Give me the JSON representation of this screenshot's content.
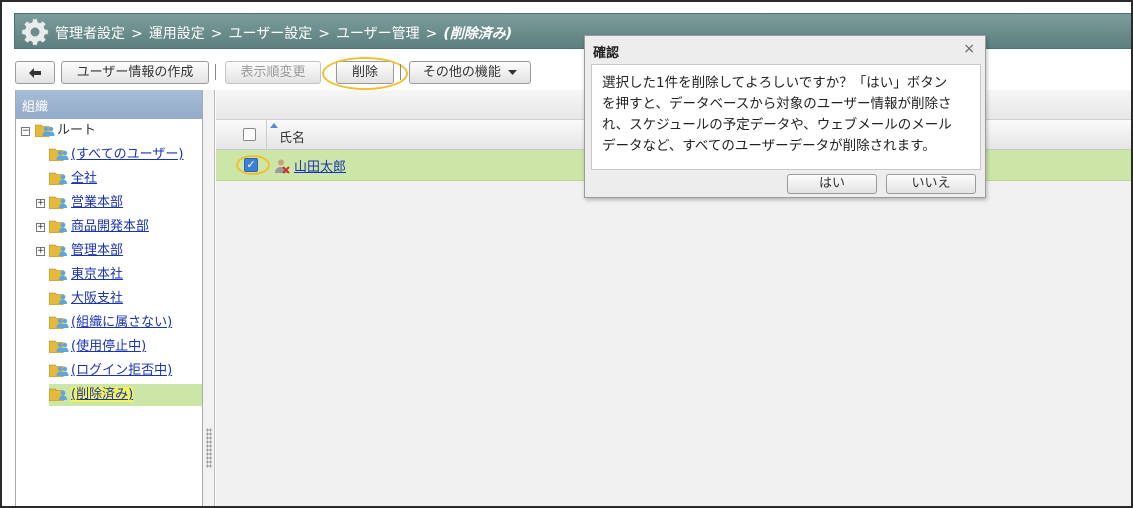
{
  "breadcrumb": {
    "items": [
      "管理者設定",
      "運用設定",
      "ユーザー設定",
      "ユーザー管理"
    ],
    "current": "(削除済み)",
    "separator": ">"
  },
  "toolbar": {
    "back_icon": "back-arrow-icon",
    "create_label": "ユーザー情報の作成",
    "sort_label": "表示順変更",
    "delete_label": "削除",
    "more_label": "その他の機能",
    "divider": "|"
  },
  "sidebar": {
    "header": "組織",
    "root_label": "ルート",
    "items": [
      {
        "label": "(すべてのユーザー)",
        "icon": "multi-user-folder-icon"
      },
      {
        "label": "全社",
        "icon": "user-folder-icon"
      },
      {
        "label": "営業本部",
        "icon": "user-folder-icon",
        "expandable": true
      },
      {
        "label": "商品開発本部",
        "icon": "user-folder-icon",
        "expandable": true
      },
      {
        "label": "管理本部",
        "icon": "user-folder-icon",
        "expandable": true
      },
      {
        "label": "東京本社",
        "icon": "user-folder-icon"
      },
      {
        "label": "大阪支社",
        "icon": "user-folder-icon"
      },
      {
        "label": "(組織に属さない)",
        "icon": "multi-user-folder-icon"
      },
      {
        "label": "(使用停止中)",
        "icon": "multi-user-folder-icon"
      },
      {
        "label": "(ログイン拒否中)",
        "icon": "multi-user-folder-icon"
      },
      {
        "label": "(削除済み)",
        "icon": "user-folder-icon",
        "selected": true
      }
    ]
  },
  "list": {
    "column_name": "氏名",
    "rows": [
      {
        "name": "山田太郎",
        "checked": true,
        "icon": "deleted-user-icon"
      }
    ]
  },
  "dialog": {
    "title": "確認",
    "message_lines": [
      "選択した1件を削除してよろしいですか？「はい」ボタン",
      "を押すと、データベースから対象のユーザー情報が削除さ",
      "れ、スケジュールの予定データや、ウェブメールのメール",
      "データなど、すべてのユーザーデータが削除されます。"
    ],
    "yes_label": "はい",
    "no_label": "いいえ",
    "close_glyph": "×"
  },
  "colors": {
    "titlebar": "#6b8e8d",
    "sidebar_header": "#9bb3cf",
    "selection": "#cce6a8",
    "link": "#1a33b5",
    "highlight": "#f0c030"
  }
}
